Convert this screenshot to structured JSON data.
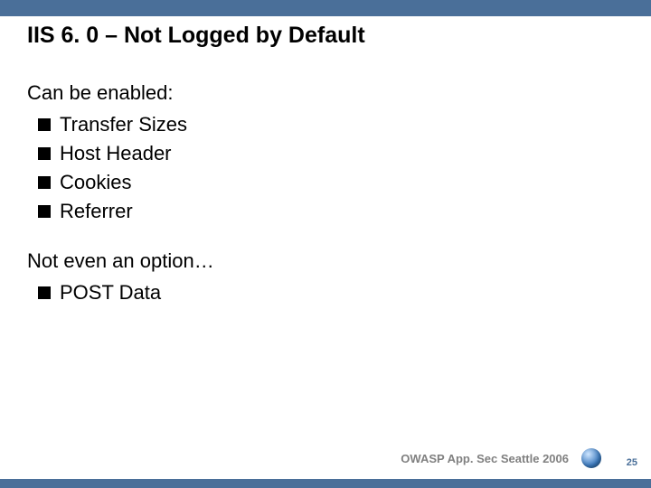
{
  "layout": {
    "top_bar_color": "#4a6f99",
    "bottom_bar_color": "#4a6f99"
  },
  "title": "IIS 6. 0 – Not Logged by Default",
  "section1": {
    "heading": "Can be enabled:",
    "items": [
      "Transfer Sizes",
      "Host Header",
      "Cookies",
      "Referrer"
    ]
  },
  "section2": {
    "heading": "Not even an option…",
    "items": [
      "POST Data"
    ]
  },
  "footer": {
    "text": "OWASP App. Sec Seattle 2006",
    "page_number": "25"
  }
}
